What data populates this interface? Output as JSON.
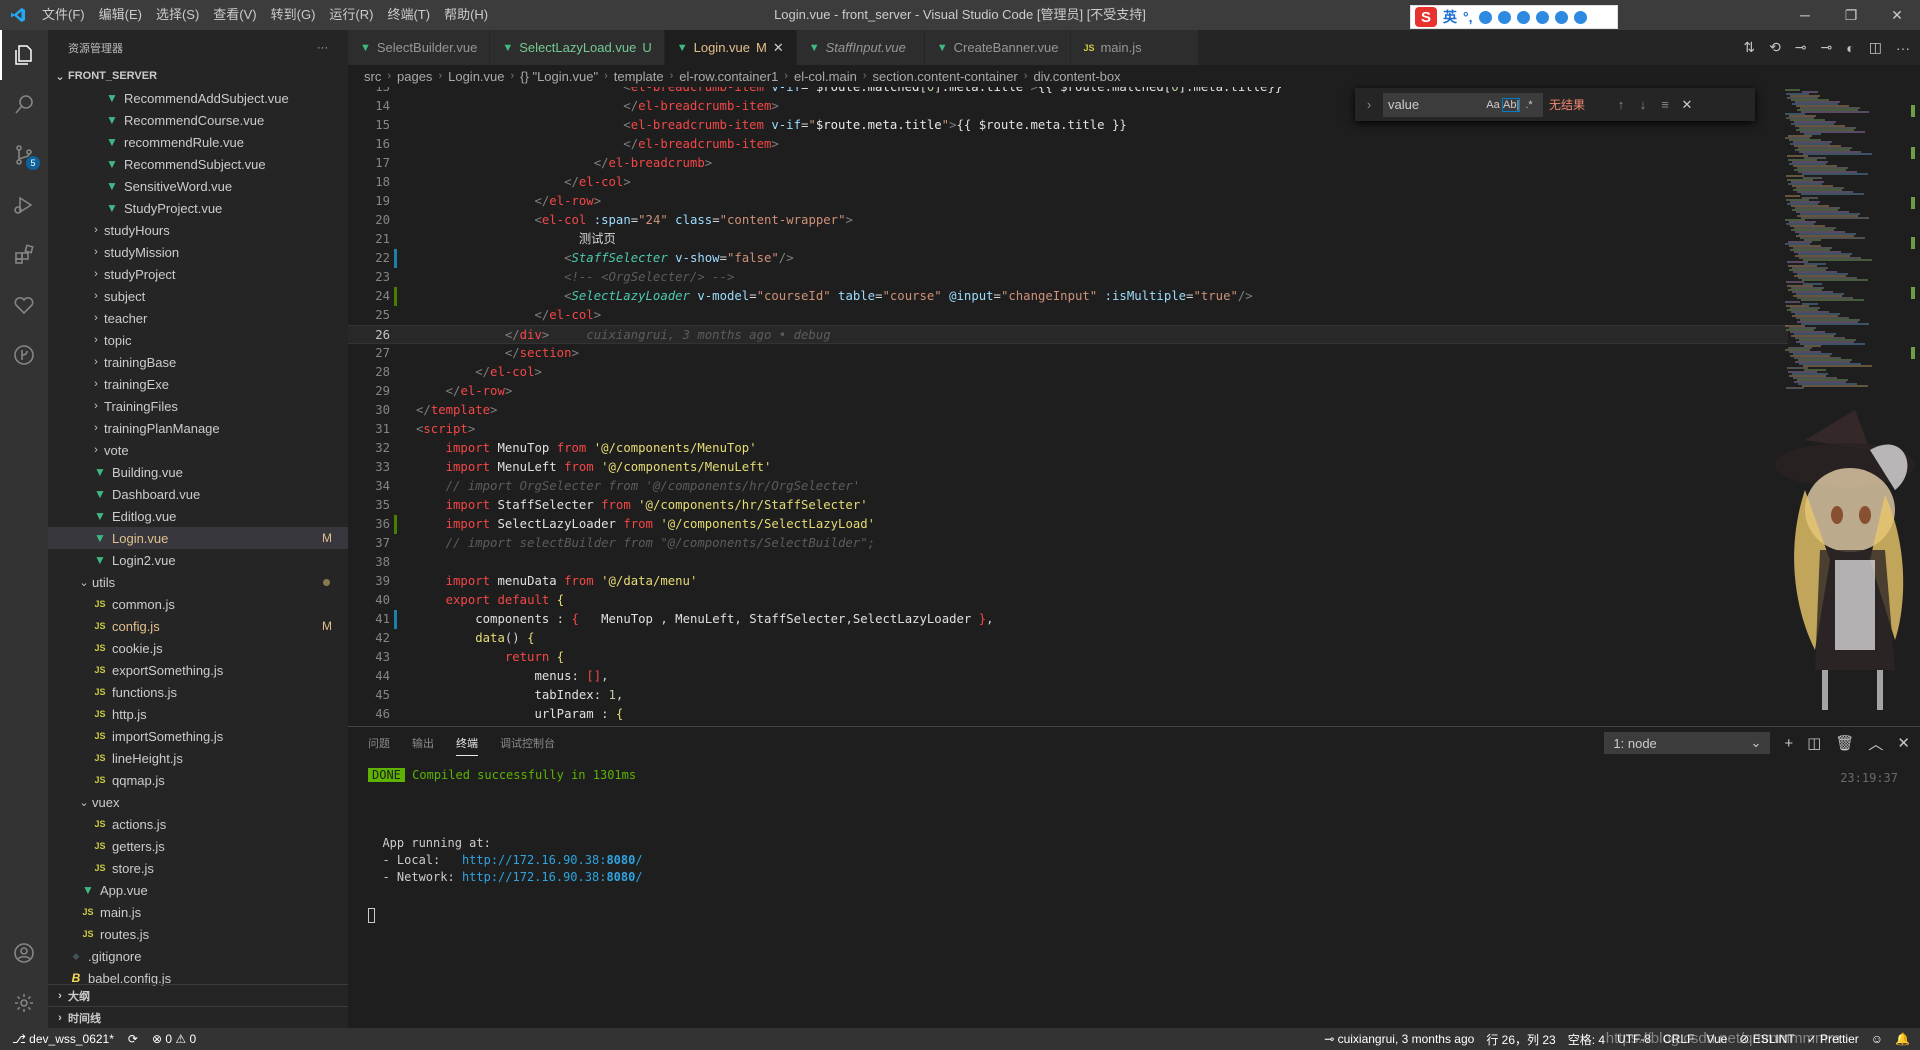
{
  "titlebar": {
    "menu": [
      "文件(F)",
      "编辑(E)",
      "选择(S)",
      "查看(V)",
      "转到(G)",
      "运行(R)",
      "终端(T)",
      "帮助(H)"
    ],
    "title": "Login.vue - front_server - Visual Studio Code [管理员] [不受支持]",
    "ime_lang": "英"
  },
  "activity": {
    "scm_badge": "5"
  },
  "sidebar": {
    "header": "资源管理器",
    "more": "···",
    "section": "FRONT_SERVER",
    "items": [
      {
        "label": "RecommendAddSubject.vue",
        "type": "vue",
        "indent": 2
      },
      {
        "label": "RecommendCourse.vue",
        "type": "vue",
        "indent": 2
      },
      {
        "label": "recommendRule.vue",
        "type": "vue",
        "indent": 2
      },
      {
        "label": "RecommendSubject.vue",
        "type": "vue",
        "indent": 2
      },
      {
        "label": "SensitiveWord.vue",
        "type": "vue",
        "indent": 2
      },
      {
        "label": "StudyProject.vue",
        "type": "vue",
        "indent": 2
      },
      {
        "label": "studyHours",
        "type": "folder",
        "indent": 1
      },
      {
        "label": "studyMission",
        "type": "folder",
        "indent": 1
      },
      {
        "label": "studyProject",
        "type": "folder",
        "indent": 1
      },
      {
        "label": "subject",
        "type": "folder",
        "indent": 1
      },
      {
        "label": "teacher",
        "type": "folder",
        "indent": 1
      },
      {
        "label": "topic",
        "type": "folder",
        "indent": 1
      },
      {
        "label": "trainingBase",
        "type": "folder",
        "indent": 1
      },
      {
        "label": "trainingExe",
        "type": "folder",
        "indent": 1
      },
      {
        "label": "TrainingFiles",
        "type": "folder",
        "indent": 1
      },
      {
        "label": "trainingPlanManage",
        "type": "folder",
        "indent": 1
      },
      {
        "label": "vote",
        "type": "folder",
        "indent": 1
      },
      {
        "label": "Building.vue",
        "type": "vue",
        "indent": 1
      },
      {
        "label": "Dashboard.vue",
        "type": "vue",
        "indent": 1
      },
      {
        "label": "Editlog.vue",
        "type": "vue",
        "indent": 1
      },
      {
        "label": "Login.vue",
        "type": "vue",
        "indent": 1,
        "selected": true,
        "mark": "M"
      },
      {
        "label": "Login2.vue",
        "type": "vue",
        "indent": 1
      },
      {
        "label": "utils",
        "type": "folder-open",
        "indent": 0,
        "dot": true
      },
      {
        "label": "common.js",
        "type": "js",
        "indent": 1
      },
      {
        "label": "config.js",
        "type": "js",
        "indent": 1,
        "mark": "M"
      },
      {
        "label": "cookie.js",
        "type": "js",
        "indent": 1
      },
      {
        "label": "exportSomething.js",
        "type": "js",
        "indent": 1
      },
      {
        "label": "functions.js",
        "type": "js",
        "indent": 1
      },
      {
        "label": "http.js",
        "type": "js",
        "indent": 1
      },
      {
        "label": "importSomething.js",
        "type": "js",
        "indent": 1
      },
      {
        "label": "lineHeight.js",
        "type": "js",
        "indent": 1
      },
      {
        "label": "qqmap.js",
        "type": "js",
        "indent": 1
      },
      {
        "label": "vuex",
        "type": "folder-open",
        "indent": 0
      },
      {
        "label": "actions.js",
        "type": "js",
        "indent": 1
      },
      {
        "label": "getters.js",
        "type": "js",
        "indent": 1
      },
      {
        "label": "store.js",
        "type": "js",
        "indent": 1
      },
      {
        "label": "App.vue",
        "type": "vue",
        "indent": 0
      },
      {
        "label": "main.js",
        "type": "js",
        "indent": 0
      },
      {
        "label": "routes.js",
        "type": "js",
        "indent": 0
      },
      {
        "label": ".gitignore",
        "type": "git",
        "indent": -1
      },
      {
        "label": "babel.config.js",
        "type": "babel",
        "indent": -1
      }
    ],
    "outline": "大纲",
    "timeline": "时间线"
  },
  "tabs": [
    {
      "label": "SelectBuilder.vue",
      "status": ""
    },
    {
      "label": "SelectLazyLoad.vue",
      "status": "U"
    },
    {
      "label": "Login.vue",
      "status": "M",
      "active": true
    },
    {
      "label": "StaffInput.vue",
      "status": "",
      "italic": true
    },
    {
      "label": "CreateBanner.vue",
      "status": ""
    },
    {
      "label": "main.js",
      "status": "",
      "js": true
    }
  ],
  "breadcrumb": [
    "src",
    "pages",
    "Login.vue",
    "{} \"Login.vue\"",
    "template",
    "el-row.container1",
    "el-col.main",
    "section.content-container",
    "div.content-box"
  ],
  "find": {
    "value": "value",
    "result": "无结果",
    "opt_case": "Aa",
    "opt_word": "Ab|",
    "opt_regex": ".*"
  },
  "editor": {
    "current_line": 26,
    "blame": "cuixiangrui, 3 months ago • debug",
    "line_numbers": [
      13,
      14,
      15,
      16,
      17,
      18,
      19,
      20,
      21,
      22,
      23,
      24,
      25,
      26,
      27,
      28,
      29,
      30,
      31,
      32,
      33,
      34,
      35,
      36,
      37,
      38,
      39,
      40,
      41,
      42,
      43,
      44,
      45,
      46
    ]
  },
  "panel": {
    "tabs": [
      "问题",
      "输出",
      "终端",
      "调试控制台"
    ],
    "active_tab": "终端",
    "terminal_select": "1: node",
    "time": "23:19:37",
    "done_label": "DONE",
    "compiled": "Compiled successfully in 1301ms",
    "running": "App running at:",
    "local_label": "- Local:   ",
    "local_url": "http://172.16.90.38:",
    "local_port": "8080",
    "network_label": "- Network: ",
    "network_url": "http://172.16.90.38:",
    "network_port": "8080",
    "slash": "/"
  },
  "status": {
    "branch": "dev_wss_0621*",
    "errors": "0",
    "warnings": "0",
    "blame": "cuixiangrui, 3 months ago",
    "position": "行 26，列 23",
    "spaces": "空格: 4",
    "encoding": "UTF-8",
    "eol": "CRLF",
    "language": "Vue",
    "eslint": "ESLINT",
    "prettier": "Prettier",
    "watermark": "https://blog.csdn.net/qmmmmmmm"
  }
}
